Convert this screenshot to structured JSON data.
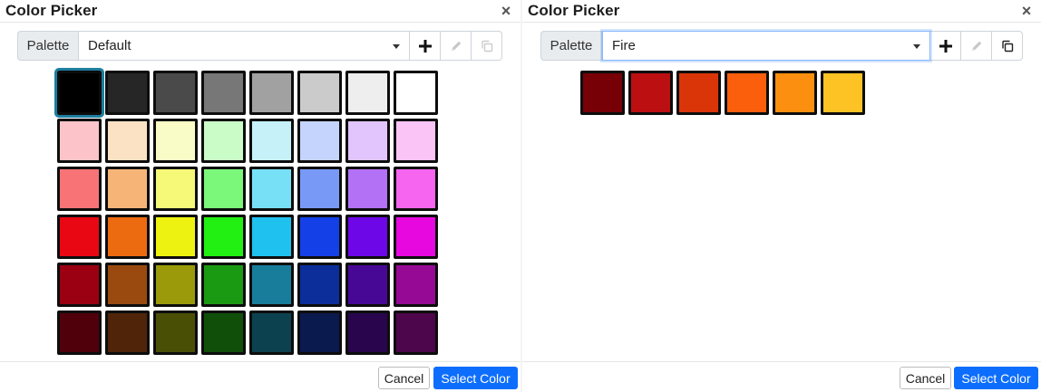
{
  "left": {
    "title": "Color Picker",
    "close_glyph": "×",
    "palette_label": "Palette",
    "palette_value": "Default",
    "icons": [
      "plus-icon",
      "pencil-icon",
      "copy-icon"
    ],
    "swatches": [
      "#000000",
      "#262626",
      "#4a4a4a",
      "#777777",
      "#a1a1a1",
      "#cbcbcb",
      "#eeeeee",
      "#ffffff",
      "#fcc4c8",
      "#fbe2c5",
      "#fafcc8",
      "#cafcc8",
      "#c6f1f8",
      "#c5d4fc",
      "#e1c5fc",
      "#fbc4f7",
      "#f87376",
      "#f6b577",
      "#f6f877",
      "#7bf779",
      "#77e0f6",
      "#7999f6",
      "#b371f6",
      "#f565ef",
      "#e80713",
      "#ec6a10",
      "#eef211",
      "#21f012",
      "#1fc1ef",
      "#1440e8",
      "#6d07e8",
      "#e608de",
      "#9a0011",
      "#9a4a0f",
      "#9a9a0b",
      "#1a9a12",
      "#177d9a",
      "#0c2e9a",
      "#480896",
      "#960994",
      "#4f000b",
      "#4f2409",
      "#4a4f06",
      "#0f4f09",
      "#0c4250",
      "#0a1a4f",
      "#28054d",
      "#4d064b"
    ],
    "selected_index": 0,
    "cancel_label": "Cancel",
    "select_label": "Select Color"
  },
  "right": {
    "title": "Color Picker",
    "close_glyph": "×",
    "palette_label": "Palette",
    "palette_value": "Fire",
    "icons": [
      "plus-icon",
      "pencil-icon",
      "copy-icon"
    ],
    "swatches": [
      "#760006",
      "#bc0f11",
      "#d93509",
      "#fc5f0c",
      "#fc8f0f",
      "#fdc324"
    ],
    "cancel_label": "Cancel",
    "select_label": "Select Color"
  }
}
